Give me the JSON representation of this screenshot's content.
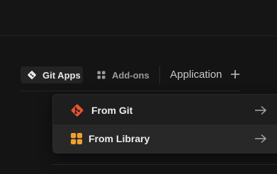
{
  "tabs": {
    "git_apps": {
      "label": "Git Apps",
      "icon": "git-icon",
      "selected": true
    },
    "addons": {
      "label": "Add-ons",
      "icon": "grid-icon",
      "selected": false
    }
  },
  "application": {
    "label": "Application",
    "add_icon": "plus-icon"
  },
  "dropdown": {
    "items": [
      {
        "label": "From Git",
        "icon": "git-logo-icon",
        "arrow": "arrow-right-icon"
      },
      {
        "label": "From Library",
        "icon": "library-icon",
        "arrow": "arrow-right-icon",
        "hovered": true
      }
    ]
  },
  "colors": {
    "background": "#141414",
    "panel": "#1e1e1e",
    "hover": "#282828",
    "git_orange": "#e8542c",
    "library_orange": "#f0a030",
    "text_primary": "#ececec",
    "text_muted": "#9a9a9a"
  }
}
